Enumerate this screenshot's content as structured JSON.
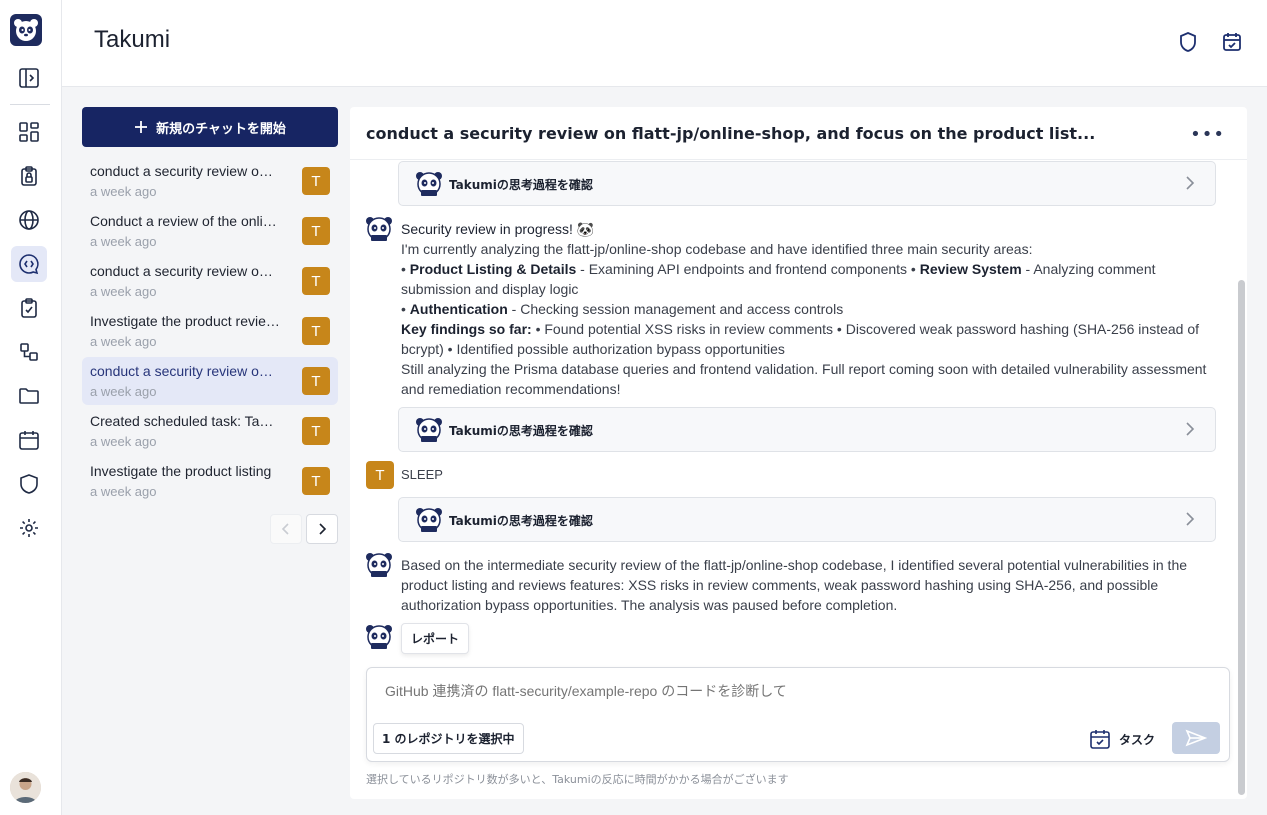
{
  "app": {
    "title": "Takumi"
  },
  "sidebar": {
    "items": [
      {
        "name": "toggle-sidebar",
        "icon": "sidebar-toggle-icon"
      },
      {
        "name": "dashboard",
        "icon": "grid-icon"
      },
      {
        "name": "clipboard-lock",
        "icon": "clipboard-lock-icon"
      },
      {
        "name": "web",
        "icon": "globe-icon"
      },
      {
        "name": "chat",
        "icon": "chat-icon",
        "active": true
      },
      {
        "name": "checklist",
        "icon": "clipboard-check-icon"
      },
      {
        "name": "workflow",
        "icon": "flow-icon"
      },
      {
        "name": "files",
        "icon": "folder-icon"
      },
      {
        "name": "schedule",
        "icon": "calendar-icon"
      },
      {
        "name": "security",
        "icon": "shield-icon"
      },
      {
        "name": "settings",
        "icon": "gear-icon"
      }
    ]
  },
  "chat_panel": {
    "new_chat_label": "新規のチャットを開始",
    "chats": [
      {
        "title": "conduct a security review on flatt-jp/online-shop",
        "time": "a week ago",
        "badge": "T",
        "selected": false
      },
      {
        "title": "Conduct a review of the online-shop",
        "time": "a week ago",
        "badge": "T",
        "selected": false
      },
      {
        "title": "conduct a security review on flatt-jp/online-shop",
        "time": "a week ago",
        "badge": "T",
        "selected": false
      },
      {
        "title": "Investigate the product reviews",
        "time": "a week ago",
        "badge": "T",
        "selected": false
      },
      {
        "title": "conduct a security review on flatt-jp/online-shop",
        "time": "a week ago",
        "badge": "T",
        "selected": true
      },
      {
        "title": "Created scheduled task: Takumi",
        "time": "a week ago",
        "badge": "T",
        "selected": false
      },
      {
        "title": "Investigate the product listing",
        "time": "a week ago",
        "badge": "T",
        "selected": false
      }
    ]
  },
  "conversation": {
    "title": "conduct a security review on flatt-jp/online-shop, and focus on the product list...",
    "thought_label": "Takumiの思考過程を確認",
    "msg1": {
      "lead": "Security review in progress! 🐼",
      "intro": "I'm currently analyzing the flatt-jp/online-shop codebase and have identified three main security areas:",
      "area1_title": "Product Listing & Details",
      "area1_text": " - Examining API endpoints and frontend components • ",
      "area2_title": "Review System",
      "area2_text": " - Analyzing comment submission and display logic",
      "area3_title": "Authentication",
      "area3_text": " - Checking session management and access controls",
      "findings_title": "Key findings so far:",
      "findings_text": " • Found potential XSS risks in review comments • Discovered weak password hashing (SHA-256 instead of bcrypt) • Identified possible authorization bypass opportunities",
      "outro": "Still analyzing the Prisma database queries and frontend validation. Full report coming soon with detailed vulnerability assessment and remediation recommendations!"
    },
    "user_msg": {
      "badge": "T",
      "text": "SLEEP"
    },
    "msg2": "Based on the intermediate security review of the flatt-jp/online-shop codebase, I identified several potential vulnerabilities in the product listing and reviews features: XSS risks in review comments, weak password hashing using SHA-256, and possible authorization bypass opportunities. The analysis was paused before completion.",
    "report_label": "レポート"
  },
  "composer": {
    "placeholder": "GitHub 連携済の flatt-security/example-repo のコードを診断して",
    "repo_label": "1 のレポジトリを選択中",
    "task_label": "タスク",
    "note": "選択しているリポジトリ数が多いと、Takumiの反応に時間がかかる場合がございます"
  },
  "colors": {
    "brand": "#172563",
    "badge": "#c7861a",
    "selected": "#e4e8f7"
  }
}
